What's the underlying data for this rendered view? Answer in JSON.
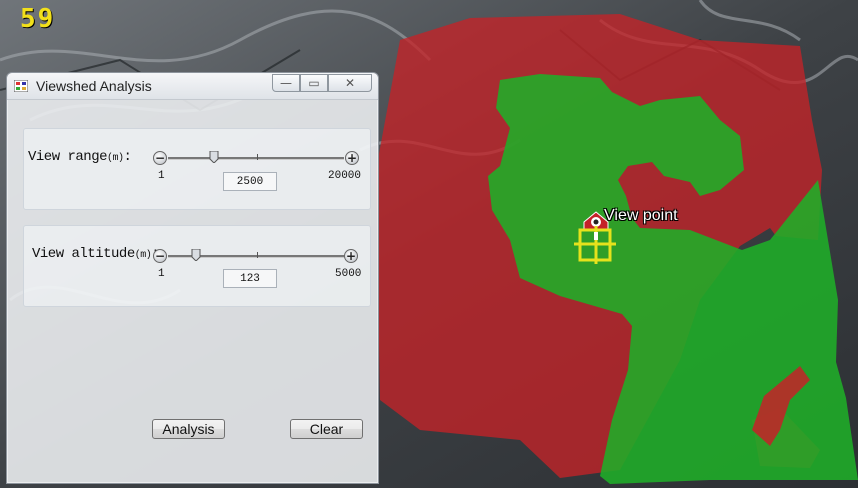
{
  "fps_counter": "59",
  "map": {
    "viewpoint_label": "View point",
    "visible_color": "#1fae28",
    "hidden_color": "#c42228"
  },
  "dialog": {
    "title": "Viewshed Analysis",
    "app_icon": "window-app-icon",
    "caption_buttons": {
      "minimize": "—",
      "maximize": "▭",
      "close": "✕"
    },
    "range": {
      "label": "View range",
      "unit": "(m)",
      "colon": ":",
      "min": "1",
      "max": "20000",
      "value": "2500",
      "slider_fraction": 0.125
    },
    "altitude": {
      "label": "View altitude",
      "unit": "(m)",
      "colon": ":",
      "min": "1",
      "max": "5000",
      "value": "123",
      "slider_fraction": 0.025
    },
    "analysis_button": "Analysis",
    "clear_button": "Clear"
  }
}
